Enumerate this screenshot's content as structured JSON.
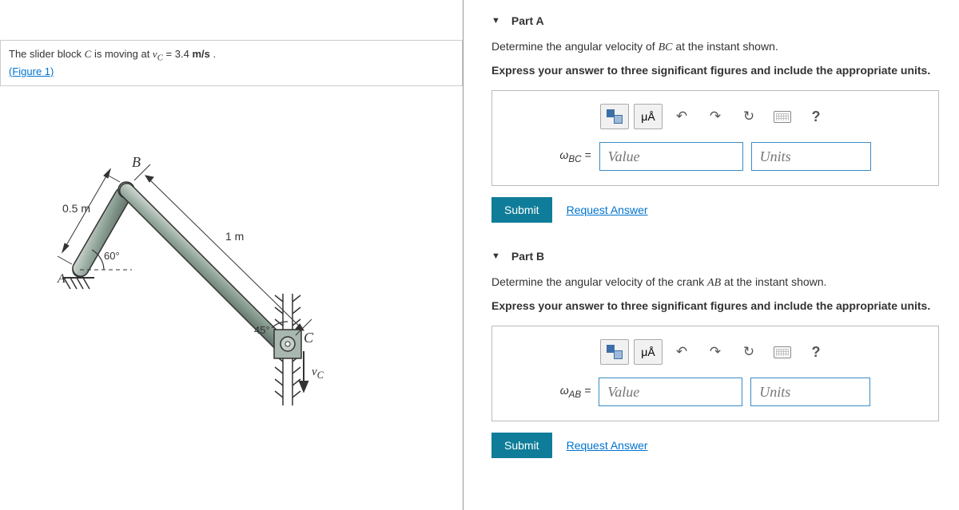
{
  "problem": {
    "text_prefix": "The slider block ",
    "text_var": "C",
    "text_mid": " is moving at ",
    "text_vc": "v_C",
    "text_eq": " = 3.4 ",
    "text_unit": "m/s",
    "text_end": " .",
    "figure_link": "(Figure 1)"
  },
  "figure": {
    "label_B": "B",
    "label_C": "C",
    "label_A": "A",
    "dim_05m": "0.5 m",
    "dim_1m": "1 m",
    "angle_60": "60°",
    "angle_45": "45°",
    "vc_label": "v_C"
  },
  "partA": {
    "title": "Part A",
    "prompt1_prefix": "Determine the angular velocity of ",
    "prompt1_var": "BC",
    "prompt1_suffix": " at the instant shown.",
    "prompt2": "Express your answer to three significant figures and include the appropriate units.",
    "var_label": "ω_BC =",
    "value_placeholder": "Value",
    "units_placeholder": "Units",
    "submit": "Submit",
    "request": "Request Answer"
  },
  "partB": {
    "title": "Part B",
    "prompt1_prefix": "Determine the angular velocity of the crank ",
    "prompt1_var": "AB",
    "prompt1_suffix": " at the instant shown.",
    "prompt2": "Express your answer to three significant figures and include the appropriate units.",
    "var_label": "ω_AB =",
    "value_placeholder": "Value",
    "units_placeholder": "Units",
    "submit": "Submit",
    "request": "Request Answer"
  },
  "toolbar": {
    "units_symbol": "μÅ",
    "help": "?"
  }
}
